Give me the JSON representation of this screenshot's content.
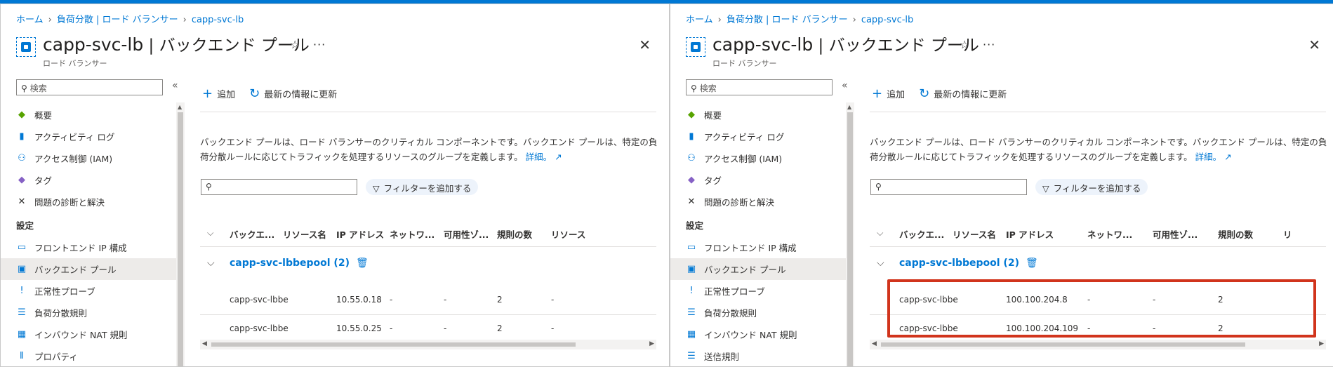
{
  "colors": {
    "accent": "#0078d4",
    "highlight": "#d1341c"
  },
  "breadcrumb": [
    "ホーム",
    "負荷分散 | ロード バランサー",
    "capp-svc-lb"
  ],
  "title_main": "capp-svc-lb",
  "title_sep": " | ",
  "title_page": "バックエンド プール",
  "subtitle": "ロード バランサー",
  "search_placeholder": "検索",
  "collapse_glyph": "«",
  "toolbar": {
    "add": "追加",
    "refresh": "最新の情報に更新"
  },
  "menu": {
    "overview": "概要",
    "activity_log": "アクティビティ ログ",
    "iam": "アクセス制御 (IAM)",
    "tags": "タグ",
    "diagnose": "問題の診断と解決",
    "settings_header": "設定",
    "frontend_ip": "フロントエンド IP 構成",
    "backend_pools": "バックエンド プール",
    "health_probes": "正常性プローブ",
    "lb_rules": "負荷分散規則",
    "inbound_nat": "インバウンド NAT 規則",
    "properties": "プロパティ",
    "outbound_rules": "送信規則"
  },
  "description": "バックエンド プールは、ロード バランサーのクリティカル コンポーネントです。バックエンド プールは、特定の負荷分散ルールに応じてトラフィックを処理するリソースのグループを定義します。",
  "learn_more": "詳細。",
  "filter_button": "フィルターを追加する",
  "columns": {
    "backend": "バックエ...",
    "resource": "リソース名",
    "ip": "IP アドレス",
    "network": "ネットワ...",
    "zone": "可用性ゾ...",
    "rules": "規則の数",
    "more_left": "リソース",
    "more_right": "リ"
  },
  "pool_name": "capp-svc-lbbepool (2)",
  "left_rows": [
    {
      "name": "capp-svc-lbbe",
      "resource": "-",
      "ip": "10.55.0.18",
      "network": "-",
      "zone": "-",
      "rules": "2",
      "extra": "-"
    },
    {
      "name": "capp-svc-lbbe",
      "resource": "-",
      "ip": "10.55.0.25",
      "network": "-",
      "zone": "-",
      "rules": "2",
      "extra": "-"
    }
  ],
  "right_rows": [
    {
      "name": "capp-svc-lbbe",
      "resource": "-",
      "ip": "100.100.204.8",
      "network": "-",
      "zone": "-",
      "rules": "2"
    },
    {
      "name": "capp-svc-lbbe",
      "resource": "-",
      "ip": "100.100.204.109",
      "network": "-",
      "zone": "-",
      "rules": "2"
    }
  ]
}
